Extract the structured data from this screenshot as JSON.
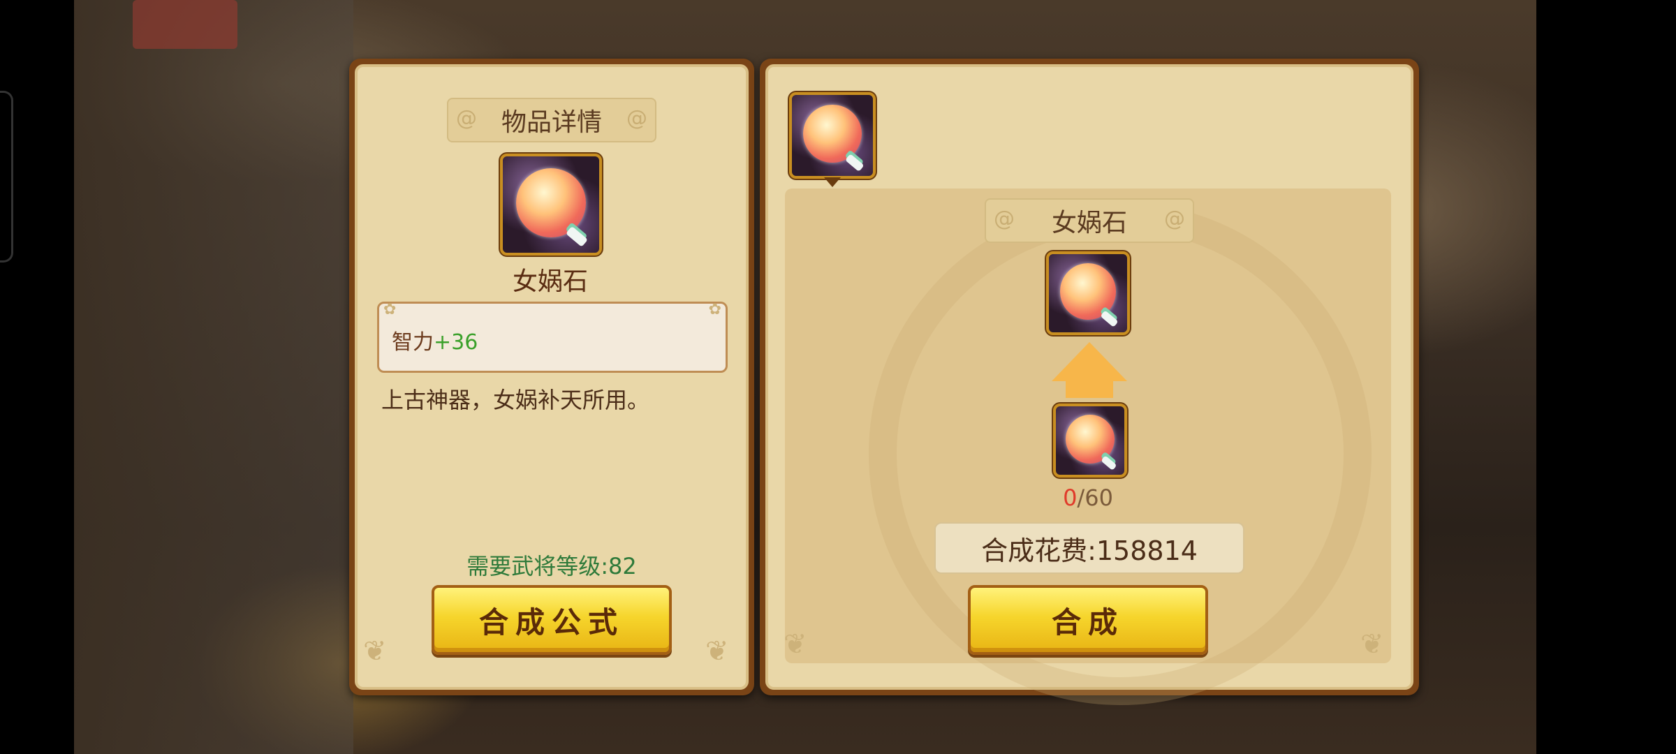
{
  "left_panel": {
    "title": "物品详情",
    "item_name": "女娲石",
    "stat_label": "智力",
    "stat_value": "+36",
    "description": "上古神器，女娲补天所用。",
    "requirement": "需要武将等级:82",
    "formula_button": "合成公式"
  },
  "right_panel": {
    "title": "女娲石",
    "material_have": "0",
    "material_need": "/60",
    "cost": "合成花费:158814",
    "synth_button": "合成"
  },
  "colors": {
    "stat_value": "#3aa02a",
    "requirement": "#2e7a3a",
    "have_count": "#e03a2a",
    "button_yellow": "#f6d52c"
  }
}
